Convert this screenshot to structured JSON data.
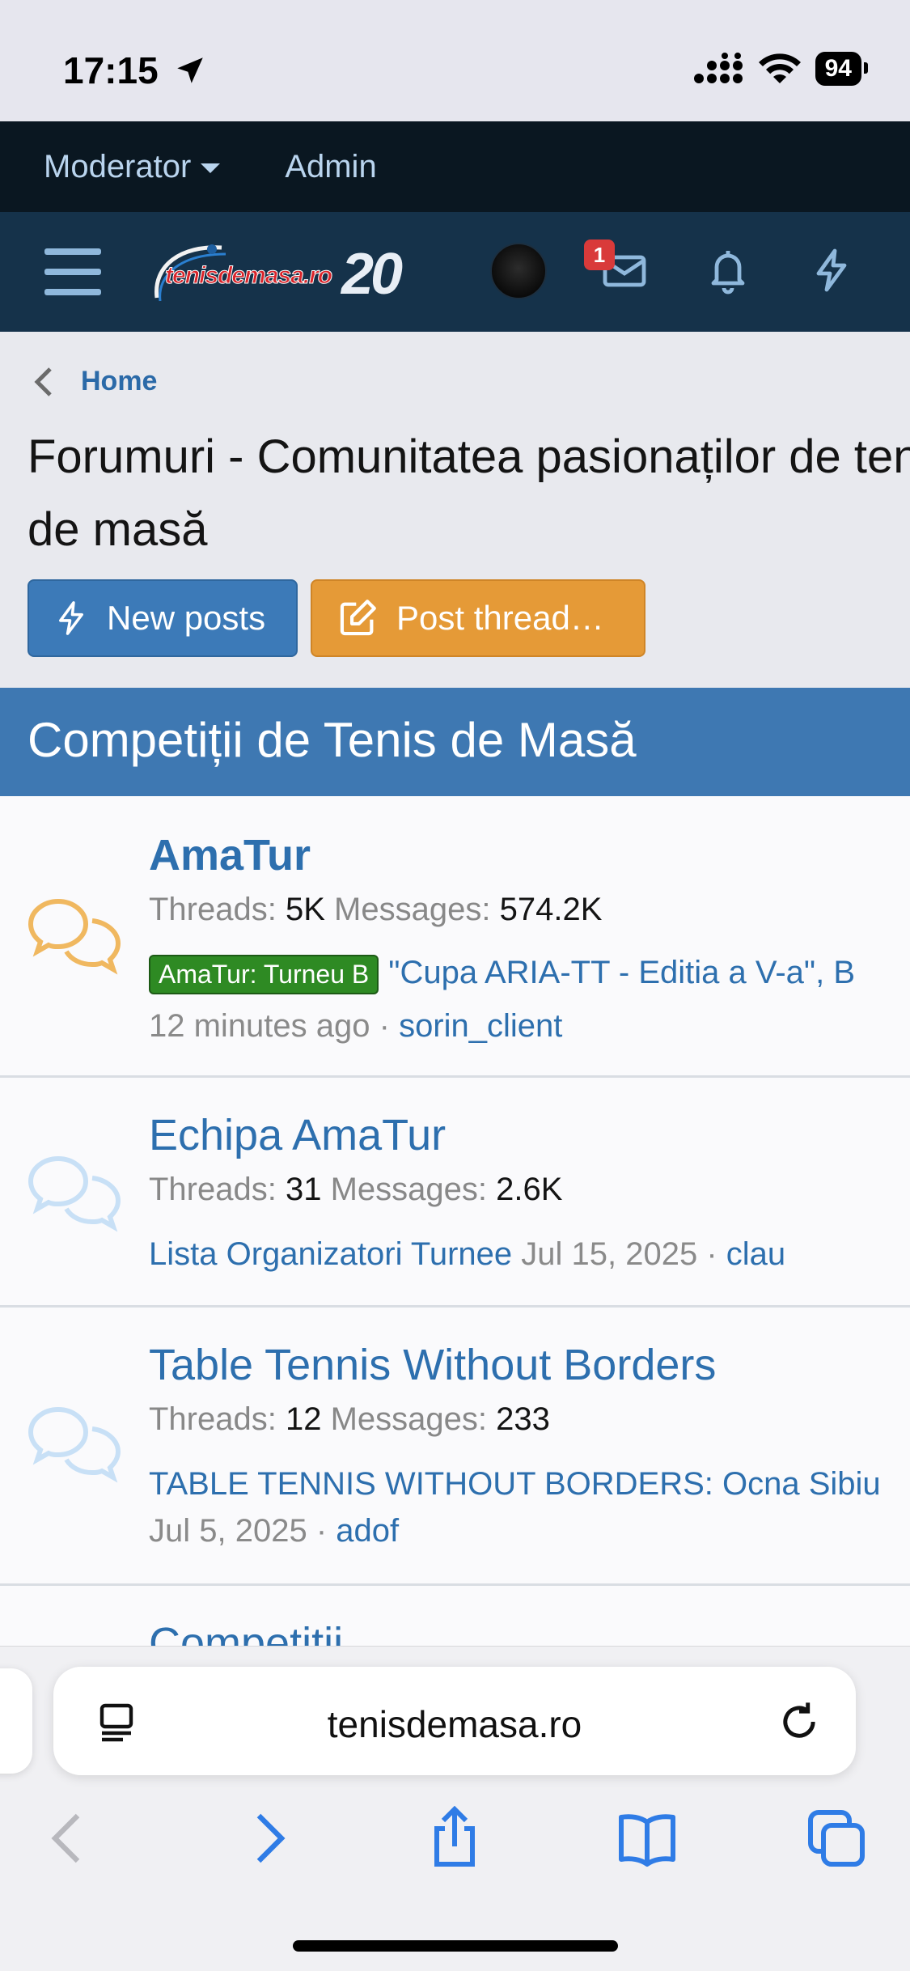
{
  "status_bar": {
    "time": "17:15",
    "battery": "94"
  },
  "staff_bar": {
    "moderator": "Moderator",
    "admin": "Admin"
  },
  "header": {
    "logo_text": "tenisdemasa.ro",
    "logo_number": "20",
    "conversations_badge": "1"
  },
  "breadcrumb": {
    "home": "Home"
  },
  "page": {
    "title": "Forumuri - Comunitatea pasionaților de tenis de masă"
  },
  "buttons": {
    "new_posts": "New posts",
    "post_thread": "Post thread…"
  },
  "category": {
    "title": "Competiții de Tenis de Masă"
  },
  "nodes": [
    {
      "title": "AmaTur",
      "threads_label": "Threads:",
      "threads": "5K",
      "messages_label": "Messages:",
      "messages": "574.2K",
      "prefix": "AmaTur: Turneu B",
      "last_thread": "\"Cupa ARIA-TT - Editia a V-a\", B",
      "last_time": "12 minutes ago",
      "last_user": "sorin_client"
    },
    {
      "title": "Echipa AmaTur",
      "threads_label": "Threads:",
      "threads": "31",
      "messages_label": "Messages:",
      "messages": "2.6K",
      "last_thread": "Lista Organizatori Turnee",
      "last_time": "Jul 15, 2025",
      "last_user": "clau"
    },
    {
      "title": "Table Tennis Without Borders",
      "threads_label": "Threads:",
      "threads": "12",
      "messages_label": "Messages:",
      "messages": "233",
      "last_thread": "TABLE TENNIS WITHOUT BORDERS: Ocna Sibiu",
      "last_time": "Jul 5, 2025",
      "last_user": "adof"
    },
    {
      "title": "Competitii"
    }
  ],
  "browser": {
    "url": "tenisdemasa.ro"
  },
  "colors": {
    "header": "#15324a",
    "accent_blue": "#3e78b2",
    "accent_orange": "#e59a37",
    "link": "#2d6fae",
    "prefix_green": "#2e8a23",
    "badge_red": "#d93a3a"
  },
  "icons": {
    "location": "location-arrow-icon",
    "signal": "signal-icon",
    "wifi": "wifi-icon",
    "menu": "hamburger-icon",
    "inbox": "inbox-icon",
    "bell": "bell-icon",
    "bolt": "bolt-icon",
    "node_unread": "chat-bubbles-icon",
    "node_read": "chat-bubbles-icon",
    "reader": "reader-icon",
    "reload": "reload-icon",
    "back": "chevron-left-icon",
    "forward": "chevron-right-icon",
    "share": "share-icon",
    "bookmarks": "book-icon",
    "tabs": "tabs-icon"
  }
}
